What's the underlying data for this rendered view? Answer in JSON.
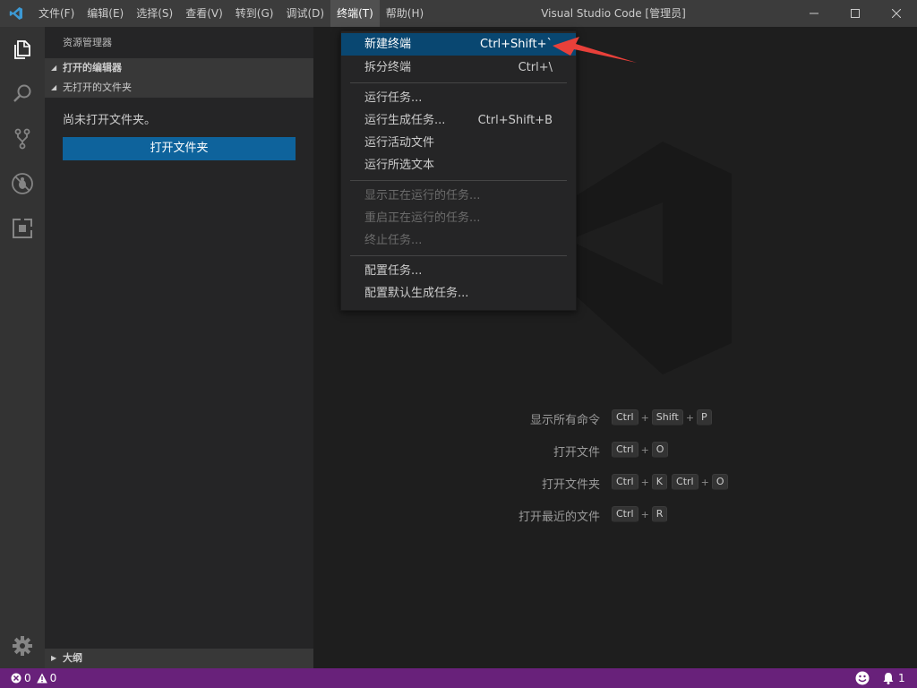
{
  "titlebar": {
    "menu": [
      "文件(F)",
      "编辑(E)",
      "选择(S)",
      "查看(V)",
      "转到(G)",
      "调试(D)",
      "终端(T)",
      "帮助(H)"
    ],
    "active_menu_index": 6,
    "window_title": "Visual Studio Code [管理员]"
  },
  "activitybar": {
    "icons": [
      "files-icon",
      "search-icon",
      "source-control-icon",
      "debug-icon",
      "extensions-icon",
      "gear-icon"
    ]
  },
  "sidebar": {
    "title": "资源管理器",
    "open_editors": "打开的编辑器",
    "no_folder_section": "无打开的文件夹",
    "no_folder_msg": "尚未打开文件夹。",
    "open_folder_button": "打开文件夹",
    "outline": "大纲"
  },
  "terminal_menu": {
    "items": [
      {
        "label": "新建终端",
        "shortcut": "Ctrl+Shift+`",
        "state": "selected"
      },
      {
        "label": "拆分终端",
        "shortcut": "Ctrl+\\",
        "state": "normal"
      },
      {
        "label": "运行任务...",
        "shortcut": "",
        "state": "normal"
      },
      {
        "label": "运行生成任务...",
        "shortcut": "Ctrl+Shift+B",
        "state": "normal"
      },
      {
        "label": "运行活动文件",
        "shortcut": "",
        "state": "normal"
      },
      {
        "label": "运行所选文本",
        "shortcut": "",
        "state": "normal"
      },
      {
        "label": "显示正在运行的任务...",
        "shortcut": "",
        "state": "disabled"
      },
      {
        "label": "重启正在运行的任务...",
        "shortcut": "",
        "state": "disabled"
      },
      {
        "label": "终止任务...",
        "shortcut": "",
        "state": "disabled"
      },
      {
        "label": "配置任务...",
        "shortcut": "",
        "state": "normal"
      },
      {
        "label": "配置默认生成任务...",
        "shortcut": "",
        "state": "normal"
      }
    ]
  },
  "shortcuts": [
    {
      "label": "显示所有命令",
      "keys": [
        [
          "Ctrl",
          "Shift",
          "P"
        ]
      ]
    },
    {
      "label": "打开文件",
      "keys": [
        [
          "Ctrl",
          "O"
        ]
      ]
    },
    {
      "label": "打开文件夹",
      "keys": [
        [
          "Ctrl",
          "K"
        ],
        [
          "Ctrl",
          "O"
        ]
      ]
    },
    {
      "label": "打开最近的文件",
      "keys": [
        [
          "Ctrl",
          "R"
        ]
      ]
    }
  ],
  "statusbar": {
    "errors": "0",
    "warnings": "0",
    "notifications": "1"
  },
  "colors": {
    "titlebar": "#3c3c3c",
    "activitybar": "#333333",
    "sidebar": "#252526",
    "editor": "#1e1e1e",
    "statusbar": "#68217a",
    "button": "#0e639c",
    "menu_selected": "#094771",
    "annotation_arrow": "#e8403a"
  }
}
